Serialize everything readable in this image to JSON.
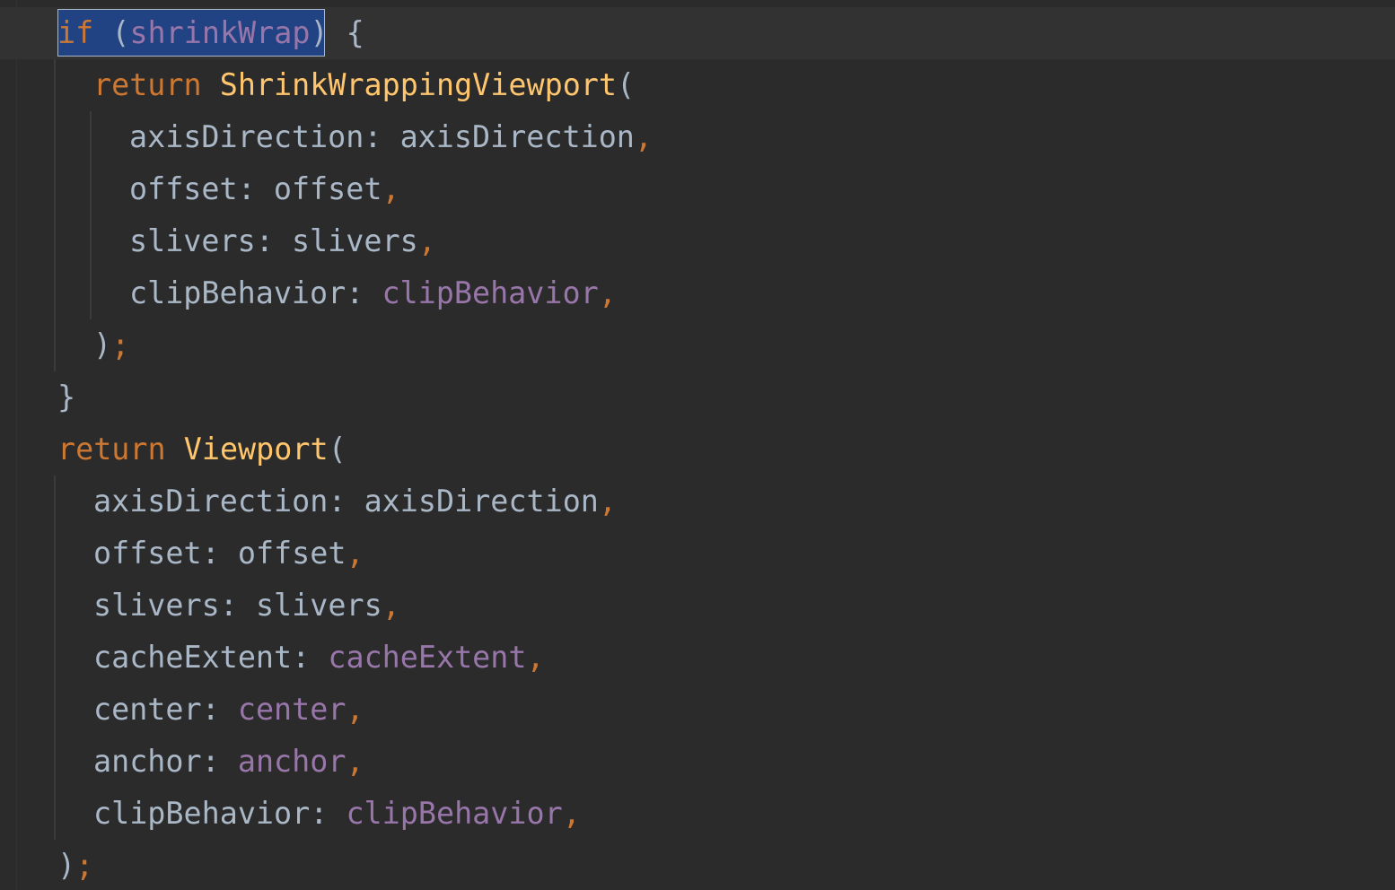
{
  "code": {
    "line1": {
      "keyword": "if",
      "paren_open": " (",
      "condition": "shrinkWrap",
      "paren_close": ")",
      "brace": " {"
    },
    "line2": {
      "keyword": "return",
      "space": " ",
      "constructor": "ShrinkWrappingViewport",
      "paren": "("
    },
    "line3": {
      "name": "axisDirection",
      "colon": ": ",
      "value": "axisDirection",
      "comma": ","
    },
    "line4": {
      "name": "offset",
      "colon": ": ",
      "value": "offset",
      "comma": ","
    },
    "line5": {
      "name": "slivers",
      "colon": ": ",
      "value": "slivers",
      "comma": ","
    },
    "line6": {
      "name": "clipBehavior",
      "colon": ": ",
      "value": "clipBehavior",
      "comma": ","
    },
    "line7": {
      "close": ")",
      "semi": ";"
    },
    "line8": {
      "brace": "}"
    },
    "line9": {
      "keyword": "return",
      "space": " ",
      "constructor": "Viewport",
      "paren": "("
    },
    "line10": {
      "name": "axisDirection",
      "colon": ": ",
      "value": "axisDirection",
      "comma": ","
    },
    "line11": {
      "name": "offset",
      "colon": ": ",
      "value": "offset",
      "comma": ","
    },
    "line12": {
      "name": "slivers",
      "colon": ": ",
      "value": "slivers",
      "comma": ","
    },
    "line13": {
      "name": "cacheExtent",
      "colon": ": ",
      "value": "cacheExtent",
      "comma": ","
    },
    "line14": {
      "name": "center",
      "colon": ": ",
      "value": "center",
      "comma": ","
    },
    "line15": {
      "name": "anchor",
      "colon": ": ",
      "value": "anchor",
      "comma": ","
    },
    "line16": {
      "name": "clipBehavior",
      "colon": ": ",
      "value": "clipBehavior",
      "comma": ","
    },
    "line17": {
      "close": ")",
      "semi": ";"
    }
  },
  "colors": {
    "background": "#2b2b2b",
    "current_line": "#323232",
    "selection": "#214283",
    "keyword": "#cc7832",
    "function": "#ffc66d",
    "field": "#9876aa",
    "text": "#a9b7c6"
  }
}
